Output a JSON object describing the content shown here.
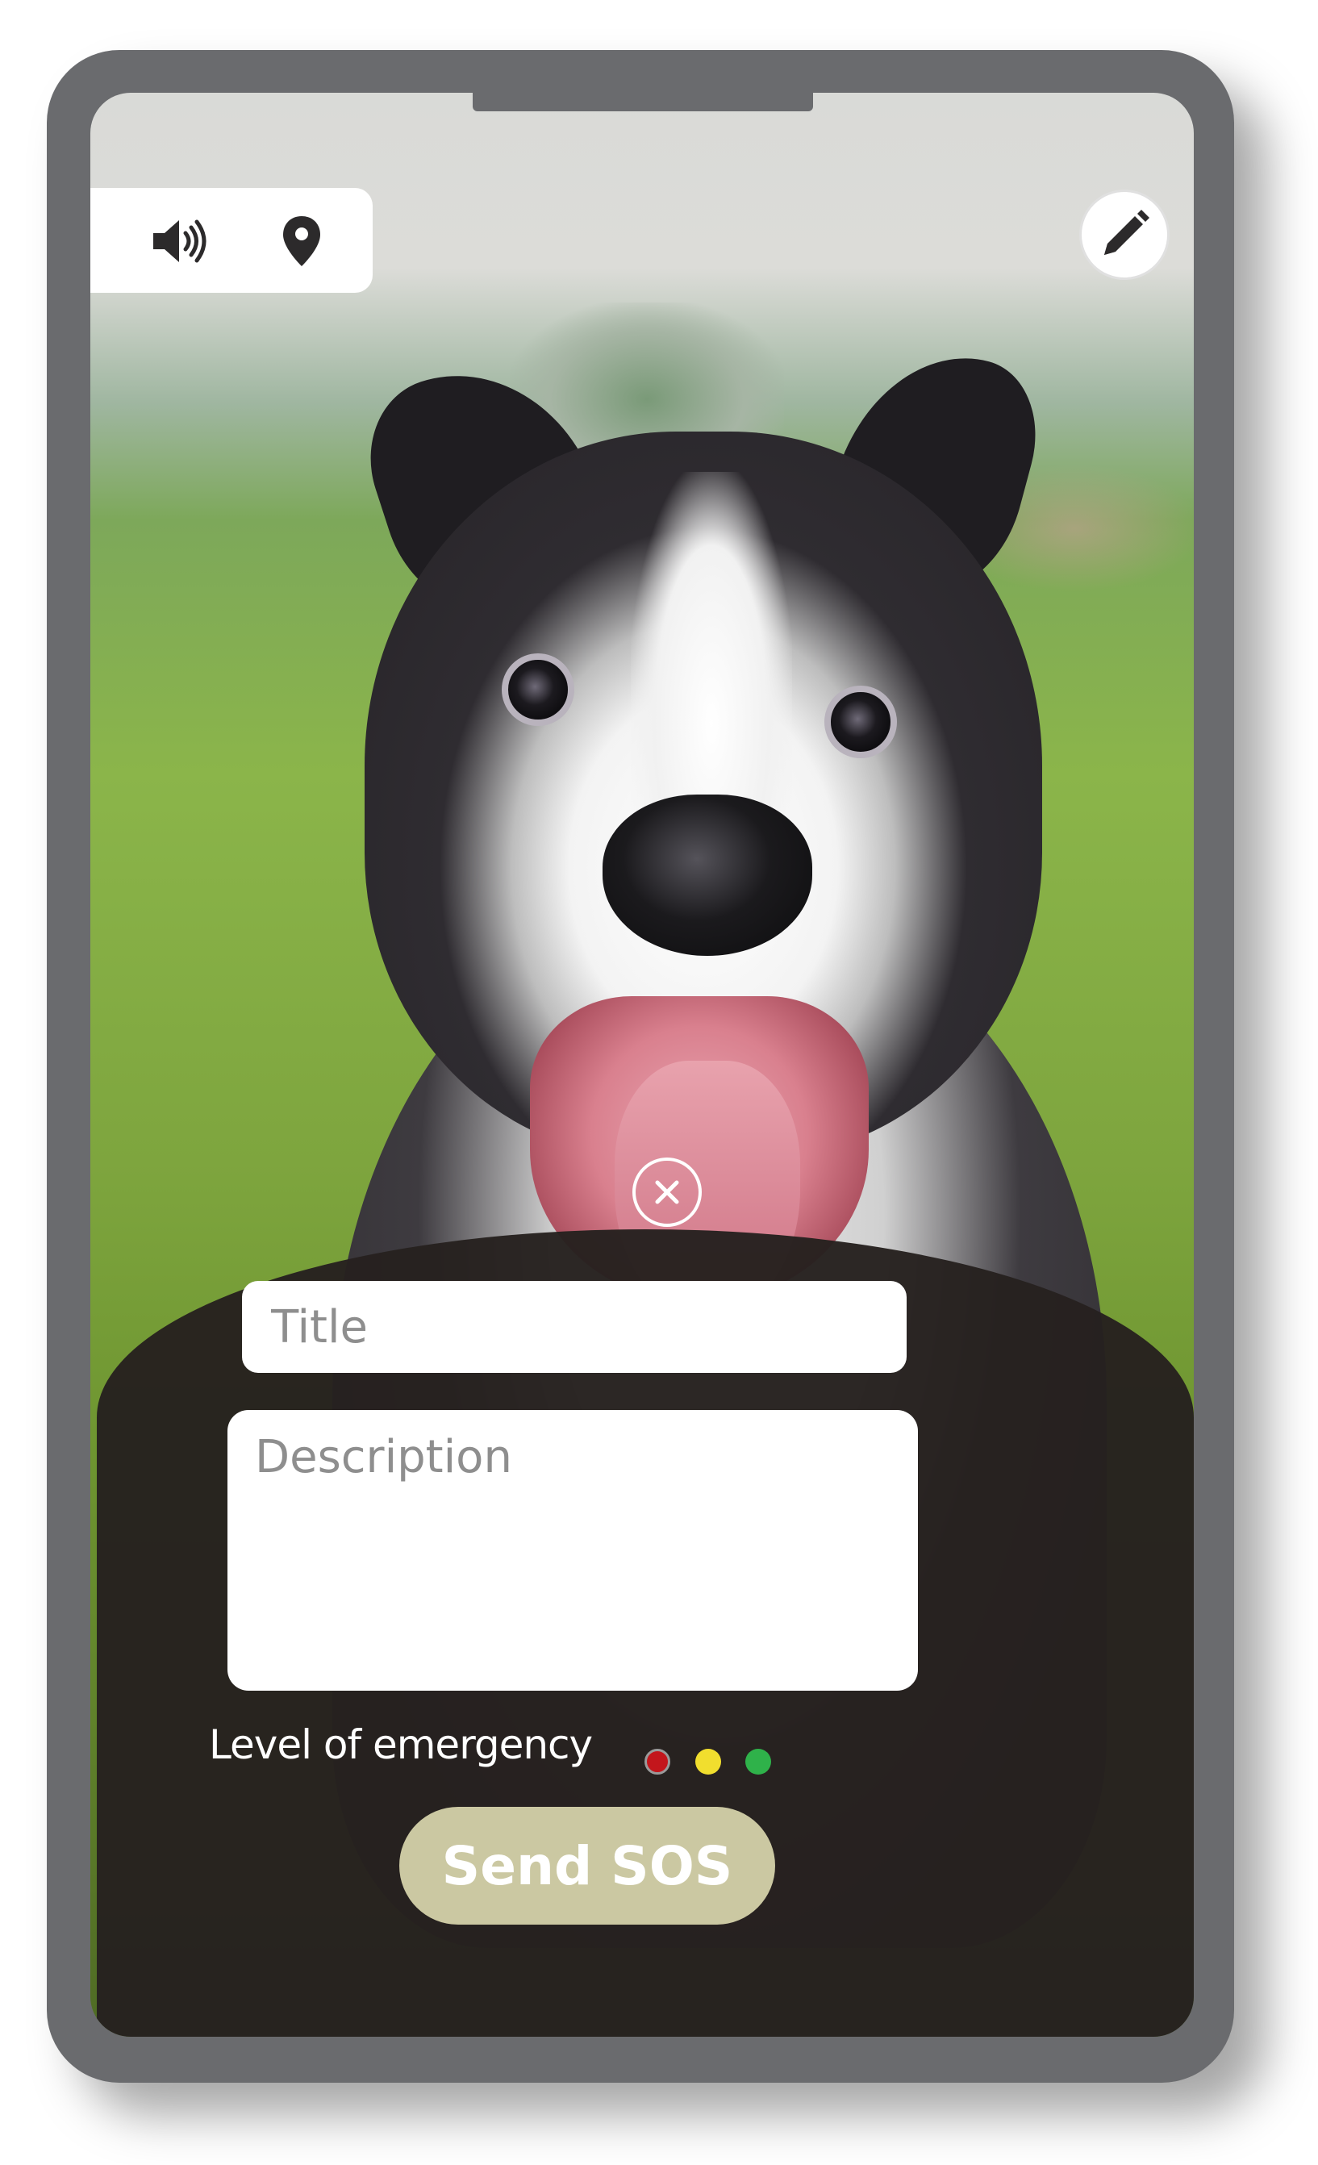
{
  "toolbar": {
    "speaker_icon": "speaker-volume-icon",
    "pin_icon": "location-pin-icon",
    "edit_icon": "pencil-icon"
  },
  "overlay": {
    "close_icon": "close-circle-icon"
  },
  "form": {
    "title_placeholder": "Title",
    "description_placeholder": "Description",
    "level_label": "Level of emergency",
    "levels": [
      {
        "name": "red",
        "color": "#c3161c"
      },
      {
        "name": "yellow",
        "color": "#f1de2e"
      },
      {
        "name": "green",
        "color": "#2fb24a"
      }
    ],
    "send_label": "Send SOS"
  },
  "colors": {
    "frame": "#6a6b6e",
    "panel": "#26211f",
    "send_button": "#cbc8a2"
  }
}
